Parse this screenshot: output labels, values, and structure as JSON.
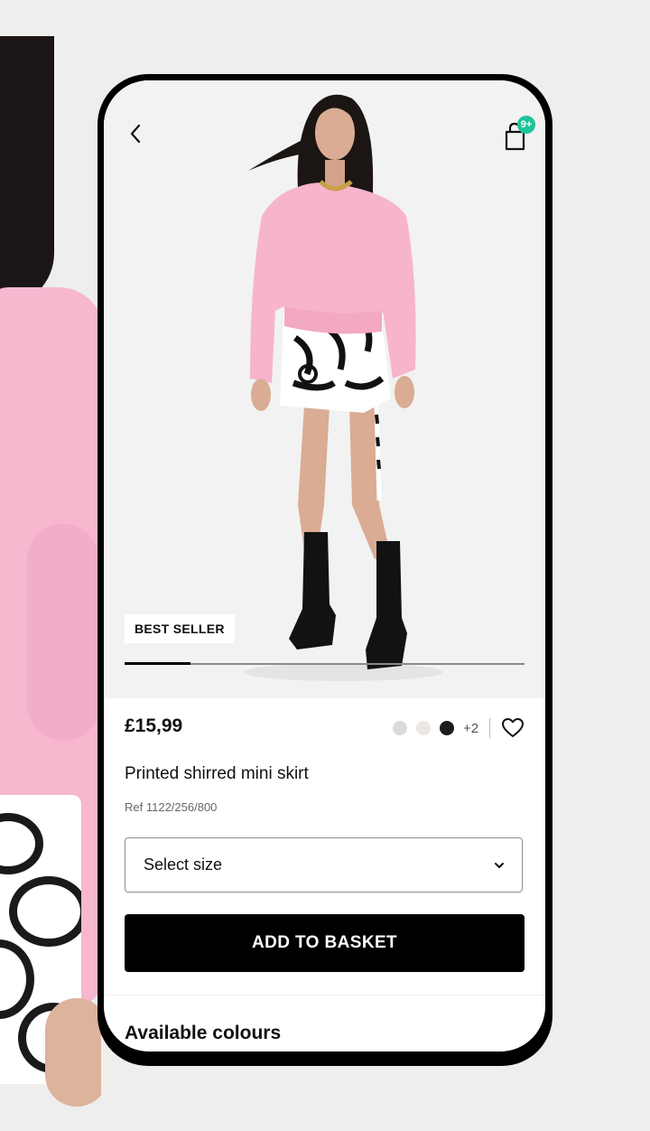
{
  "header": {
    "back_icon": "chevron-left-icon",
    "bag_icon": "shopping-bag-icon",
    "bag_count": "9+",
    "badge_color": "#1fc39a"
  },
  "gallery": {
    "badge": "BEST SELLER",
    "progress": 0.165
  },
  "product": {
    "price": "£15,99",
    "name": "Printed shirred mini skirt",
    "ref": "Ref 1122/256/800",
    "colors": [
      "#d6dcdb",
      "#ebe8e3",
      "#1c1c1c"
    ],
    "more_colors": "+2",
    "favorite_icon": "heart-outline-icon"
  },
  "size_select": {
    "label": "Select size",
    "icon": "chevron-down-icon"
  },
  "actions": {
    "add_to_basket": "ADD TO BASKET"
  },
  "sections": {
    "available_colours": "Available colours"
  }
}
